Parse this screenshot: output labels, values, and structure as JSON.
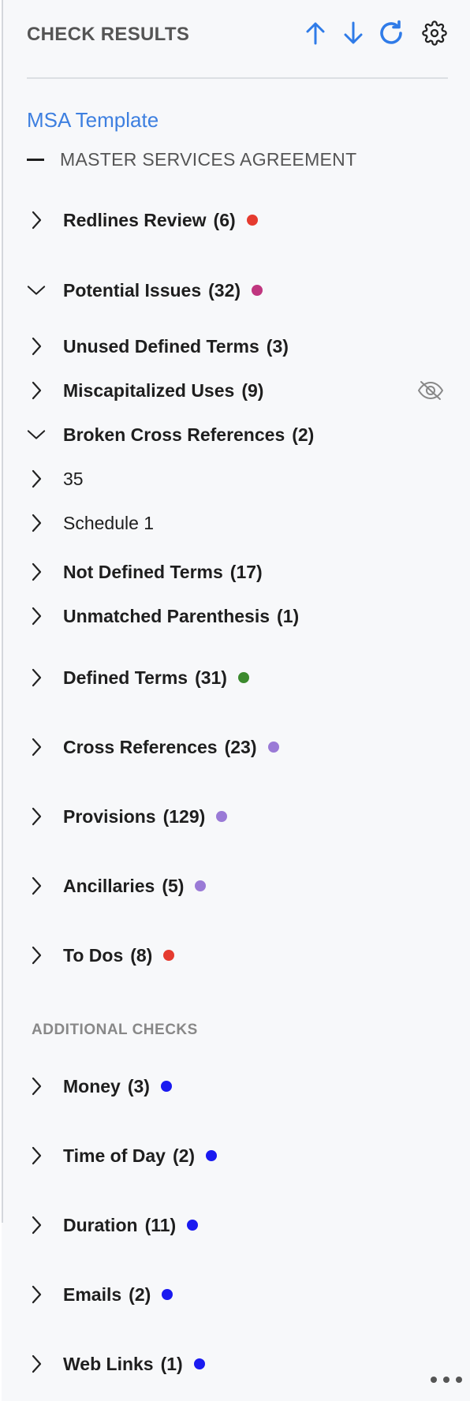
{
  "header": {
    "title": "CHECK RESULTS",
    "icons": [
      "arrow-up-icon",
      "arrow-down-icon",
      "refresh-icon",
      "gear-icon"
    ],
    "accent_color": "#2f7be8"
  },
  "document": {
    "name": "MSA Template",
    "section_title": "MASTER SERVICES AGREEMENT"
  },
  "checks": [
    {
      "label": "Redlines Review",
      "count": "(6)",
      "dot_color": "#e53b2f",
      "expanded": false
    },
    {
      "label": "Potential Issues",
      "count": "(32)",
      "dot_color": "#c0367f",
      "expanded": true
    },
    {
      "label": "Unused Defined Terms",
      "count": "(3)",
      "expanded": false
    },
    {
      "label": "Miscapitalized Uses",
      "count": "(9)",
      "expanded": false,
      "hidden_icon": "eye-off-icon"
    },
    {
      "label": "Broken Cross References",
      "count": "(2)",
      "expanded": true
    },
    {
      "label": "35",
      "expanded": false
    },
    {
      "label": "Schedule 1",
      "expanded": false
    },
    {
      "label": "Not Defined Terms",
      "count": "(17)",
      "expanded": false
    },
    {
      "label": "Unmatched Parenthesis",
      "count": "(1)",
      "expanded": false
    },
    {
      "label": "Defined Terms",
      "count": "(31)",
      "dot_color": "#3c8a2e",
      "expanded": false
    },
    {
      "label": "Cross References",
      "count": "(23)",
      "dot_color": "#9a7ad6",
      "expanded": false
    },
    {
      "label": "Provisions",
      "count": "(129)",
      "dot_color": "#9a7ad6",
      "expanded": false
    },
    {
      "label": "Ancillaries",
      "count": "(5)",
      "dot_color": "#9a7ad6",
      "expanded": false
    },
    {
      "label": "To Dos",
      "count": "(8)",
      "dot_color": "#e53b2f",
      "expanded": false
    }
  ],
  "additional_checks_title": "ADDITIONAL CHECKS",
  "additional_checks": [
    {
      "label": "Money",
      "count": "(3)",
      "dot_color": "#1a1af0"
    },
    {
      "label": "Time of Day",
      "count": "(2)",
      "dot_color": "#1a1af0"
    },
    {
      "label": "Duration",
      "count": "(11)",
      "dot_color": "#1a1af0"
    },
    {
      "label": "Emails",
      "count": "(2)",
      "dot_color": "#1a1af0"
    },
    {
      "label": "Web Links",
      "count": "(1)",
      "dot_color": "#1a1af0"
    }
  ],
  "more_menu_icon": "more-horizontal-icon"
}
